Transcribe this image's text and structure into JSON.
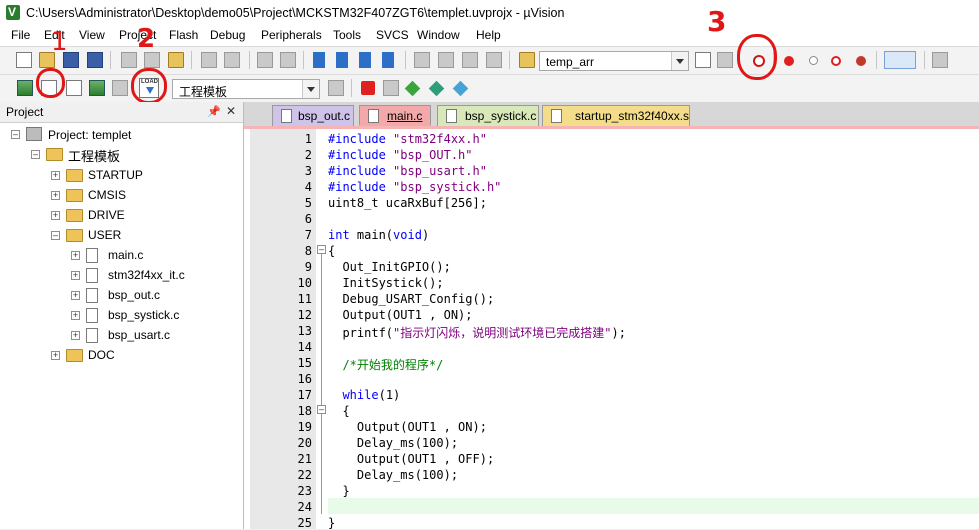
{
  "window": {
    "title": "C:\\Users\\Administrator\\Desktop\\demo05\\Project\\MCKSTM32F407ZGT6\\templet.uvprojx - µVision"
  },
  "menu": [
    "File",
    "Edit",
    "View",
    "Project",
    "Flash",
    "Debug",
    "Peripherals",
    "Tools",
    "SVCS",
    "Window",
    "Help"
  ],
  "toolbar": {
    "find_combo": "temp_arr",
    "target_combo": "工程模板"
  },
  "annotations": {
    "mark1": "1",
    "mark2": "2",
    "mark3": "3"
  },
  "project_panel": {
    "title": "Project",
    "tree": {
      "root": "Project: templet",
      "target": "工程模板",
      "groups": [
        "STARTUP",
        "CMSIS",
        "DRIVE",
        "USER",
        "DOC"
      ],
      "user_files": [
        "main.c",
        "stm32f4xx_it.c",
        "bsp_out.c",
        "bsp_systick.c",
        "bsp_usart.c"
      ]
    }
  },
  "tabs": [
    {
      "label": "bsp_out.c",
      "color": "#cfc3ea"
    },
    {
      "label": "main.c",
      "color": "#f3a9a9",
      "active": true
    },
    {
      "label": "bsp_systick.c",
      "color": "#d9e8b8"
    },
    {
      "label": "startup_stm32f40xx.s",
      "color": "#f3dc8a"
    }
  ],
  "colors": {
    "keyword": "#0000ff",
    "string": "#800080",
    "comment": "#008000",
    "annotation": "#e01717"
  },
  "code": {
    "line_numbers": [
      "1",
      "2",
      "3",
      "4",
      "5",
      "6",
      "7",
      "8",
      "9",
      "10",
      "11",
      "12",
      "13",
      "14",
      "15",
      "16",
      "17",
      "18",
      "19",
      "20",
      "21",
      "22",
      "23",
      "24",
      "25"
    ],
    "lines": [
      "#include \"stm32f4xx.h\"",
      "#include \"bsp_OUT.h\"",
      "#include \"bsp_usart.h\"",
      "#include \"bsp_systick.h\"",
      "uint8_t ucaRxBuf[256];",
      "",
      "int main(void)",
      "{",
      "  Out_InitGPIO();",
      "  InitSystick();",
      "  Debug_USART_Config();",
      "  Output(OUT1 , ON);",
      "  printf(\"指示灯闪烁，说明测试环境已完成搭建\");",
      "",
      "  /*开始我的程序*/",
      "",
      "  while(1)",
      "  {",
      "    Output(OUT1 , ON);",
      "    Delay_ms(100);",
      "    Output(OUT1 , OFF);",
      "    Delay_ms(100);",
      "  }",
      "",
      "}"
    ]
  }
}
